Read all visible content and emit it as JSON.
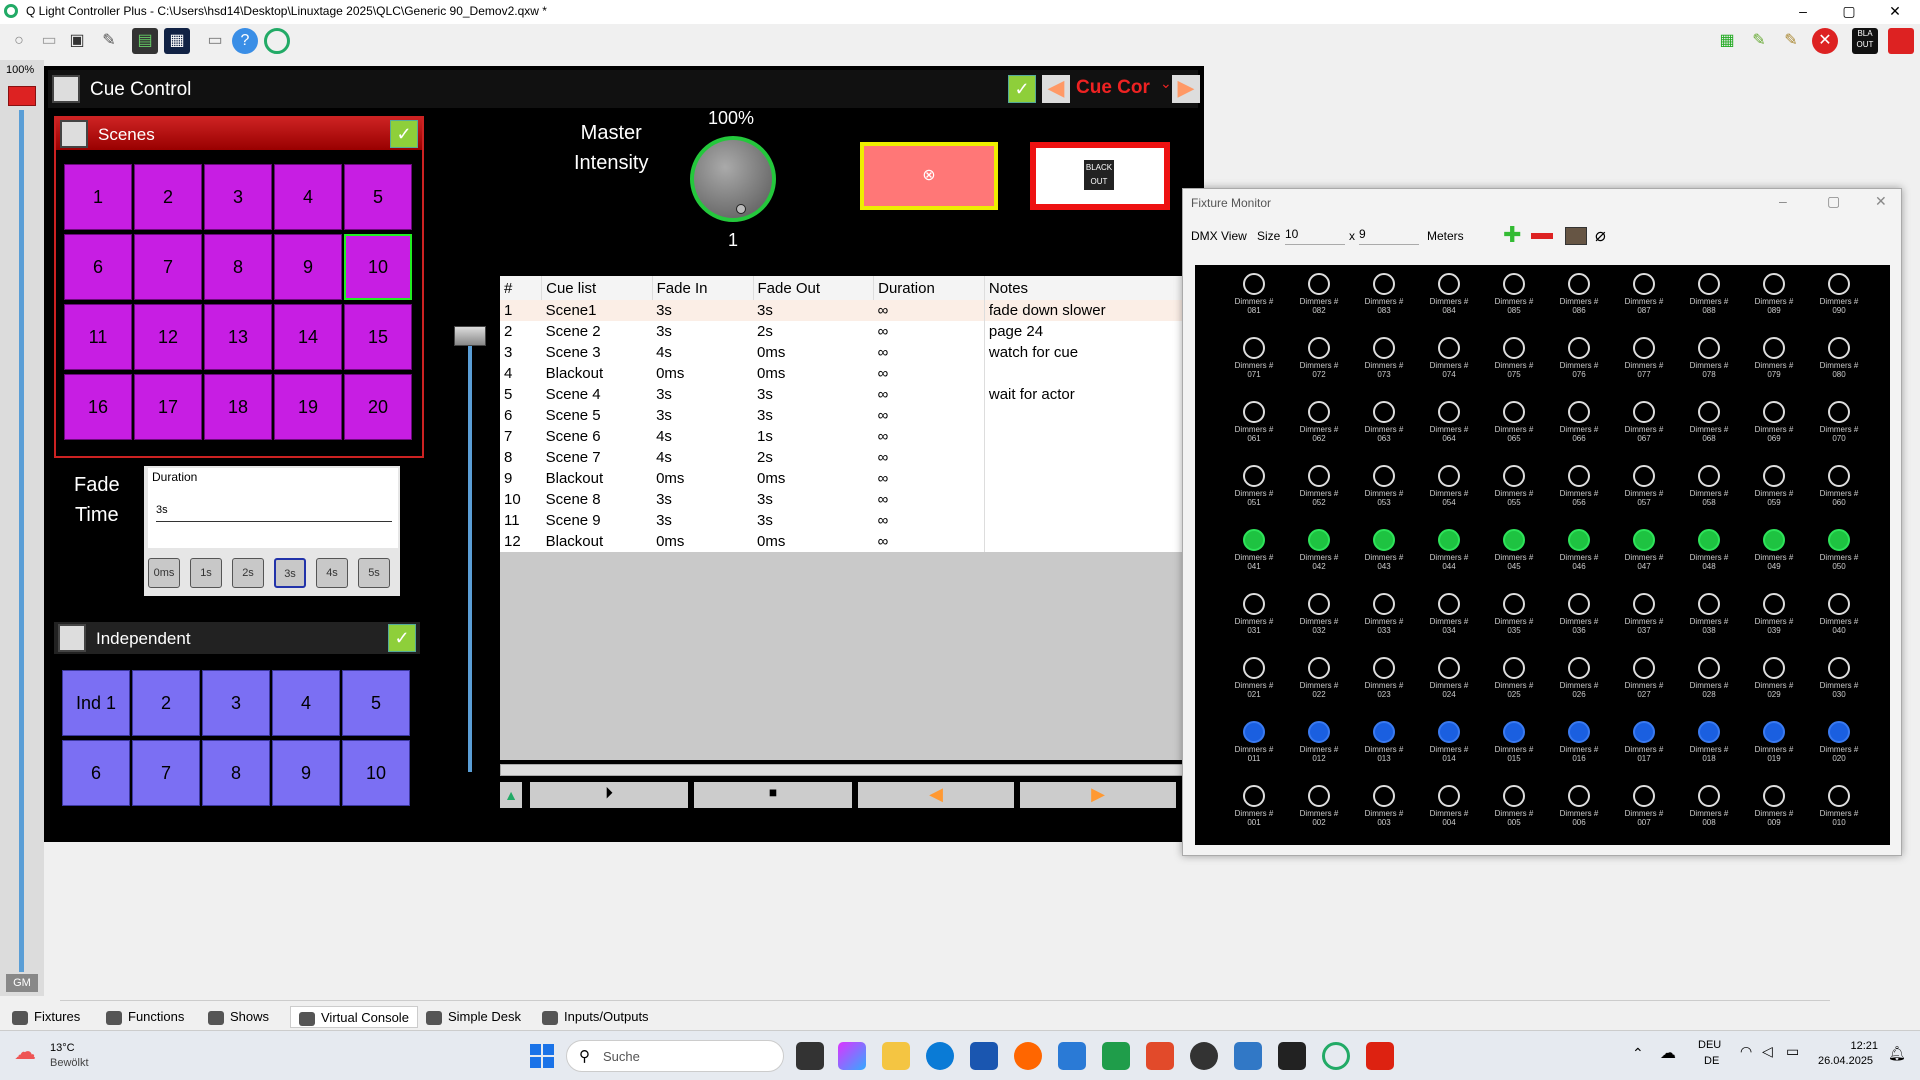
{
  "window": {
    "title": "Q Light Controller Plus - C:\\Users\\hsd14\\Desktop\\Linuxtage 2025\\QLC\\Generic 90_Demov2.qxw *"
  },
  "left_strip": {
    "top_label": "100%",
    "bottom_label": "GM"
  },
  "cue_control": {
    "title": "Cue Control",
    "cue_label": "Cue Cor"
  },
  "scenes": {
    "title": "Scenes",
    "buttons": [
      "1",
      "2",
      "3",
      "4",
      "5",
      "6",
      "7",
      "8",
      "9",
      "10",
      "11",
      "12",
      "13",
      "14",
      "15",
      "16",
      "17",
      "18",
      "19",
      "20"
    ]
  },
  "fade": {
    "label_line1": "Fade",
    "label_line2": "Time",
    "box_title": "Duration",
    "value": "3s",
    "presets": [
      "0ms",
      "1s",
      "2s",
      "3s",
      "4s",
      "5s"
    ]
  },
  "independent": {
    "title": "Independent",
    "buttons": [
      "Ind 1",
      "2",
      "3",
      "4",
      "5",
      "6",
      "7",
      "8",
      "9",
      "10"
    ]
  },
  "master": {
    "label_line1": "Master",
    "label_line2": "Intensity",
    "percent": "100%",
    "value": "1"
  },
  "blackout": {
    "label": "BLACK OUT"
  },
  "cuelist": {
    "headers": [
      "#",
      "Cue list",
      "Fade In",
      "Fade Out",
      "Duration",
      "Notes"
    ],
    "rows": [
      [
        "1",
        "Scene1",
        "3s",
        "3s",
        "∞",
        "fade down slower"
      ],
      [
        "2",
        "Scene 2",
        "3s",
        "2s",
        "∞",
        "page 24"
      ],
      [
        "3",
        "Scene 3",
        "4s",
        "0ms",
        "∞",
        "watch for cue"
      ],
      [
        "4",
        "Blackout",
        "0ms",
        "0ms",
        "∞",
        ""
      ],
      [
        "5",
        "Scene 4",
        "3s",
        "3s",
        "∞",
        "wait for actor"
      ],
      [
        "6",
        "Scene 5",
        "3s",
        "3s",
        "∞",
        ""
      ],
      [
        "7",
        "Scene 6",
        "4s",
        "1s",
        "∞",
        ""
      ],
      [
        "8",
        "Scene 7",
        "4s",
        "2s",
        "∞",
        ""
      ],
      [
        "9",
        "Blackout",
        "0ms",
        "0ms",
        "∞",
        ""
      ],
      [
        "10",
        "Scene 8",
        "3s",
        "3s",
        "∞",
        ""
      ],
      [
        "11",
        "Scene 9",
        "3s",
        "3s",
        "∞",
        ""
      ],
      [
        "12",
        "Blackout",
        "0ms",
        "0ms",
        "∞",
        ""
      ]
    ]
  },
  "fixture_monitor": {
    "title": "Fixture Monitor",
    "dmx_view": "DMX View",
    "size_label": "Size",
    "size_w": "10",
    "x": "x",
    "size_h": "9",
    "units": "Meters",
    "fixture_label": "Dimmers #",
    "rows": [
      {
        "state": "off",
        "ids": [
          "081",
          "082",
          "083",
          "084",
          "085",
          "086",
          "087",
          "088",
          "089",
          "090"
        ]
      },
      {
        "state": "off",
        "ids": [
          "071",
          "072",
          "073",
          "074",
          "075",
          "076",
          "077",
          "078",
          "079",
          "080"
        ]
      },
      {
        "state": "off",
        "ids": [
          "061",
          "062",
          "063",
          "064",
          "065",
          "066",
          "067",
          "068",
          "069",
          "070"
        ]
      },
      {
        "state": "off",
        "ids": [
          "051",
          "052",
          "053",
          "054",
          "055",
          "056",
          "057",
          "058",
          "059",
          "060"
        ]
      },
      {
        "state": "green",
        "ids": [
          "041",
          "042",
          "043",
          "044",
          "045",
          "046",
          "047",
          "048",
          "049",
          "050"
        ]
      },
      {
        "state": "off",
        "ids": [
          "031",
          "032",
          "033",
          "034",
          "035",
          "036",
          "037",
          "038",
          "039",
          "040"
        ]
      },
      {
        "state": "off",
        "ids": [
          "021",
          "022",
          "023",
          "024",
          "025",
          "026",
          "027",
          "028",
          "029",
          "030"
        ]
      },
      {
        "state": "blue",
        "ids": [
          "011",
          "012",
          "013",
          "014",
          "015",
          "016",
          "017",
          "018",
          "019",
          "020"
        ]
      },
      {
        "state": "off",
        "ids": [
          "001",
          "002",
          "003",
          "004",
          "005",
          "006",
          "007",
          "008",
          "009",
          "010"
        ]
      }
    ]
  },
  "bottom_tabs": [
    "Fixtures",
    "Functions",
    "Shows",
    "Virtual Console",
    "Simple Desk",
    "Inputs/Outputs"
  ],
  "taskbar": {
    "weather_temp": "13°C",
    "weather_desc": "Bewölkt",
    "search": "Suche",
    "lang1": "DEU",
    "lang2": "DE",
    "time": "12:21",
    "date": "26.04.2025"
  }
}
